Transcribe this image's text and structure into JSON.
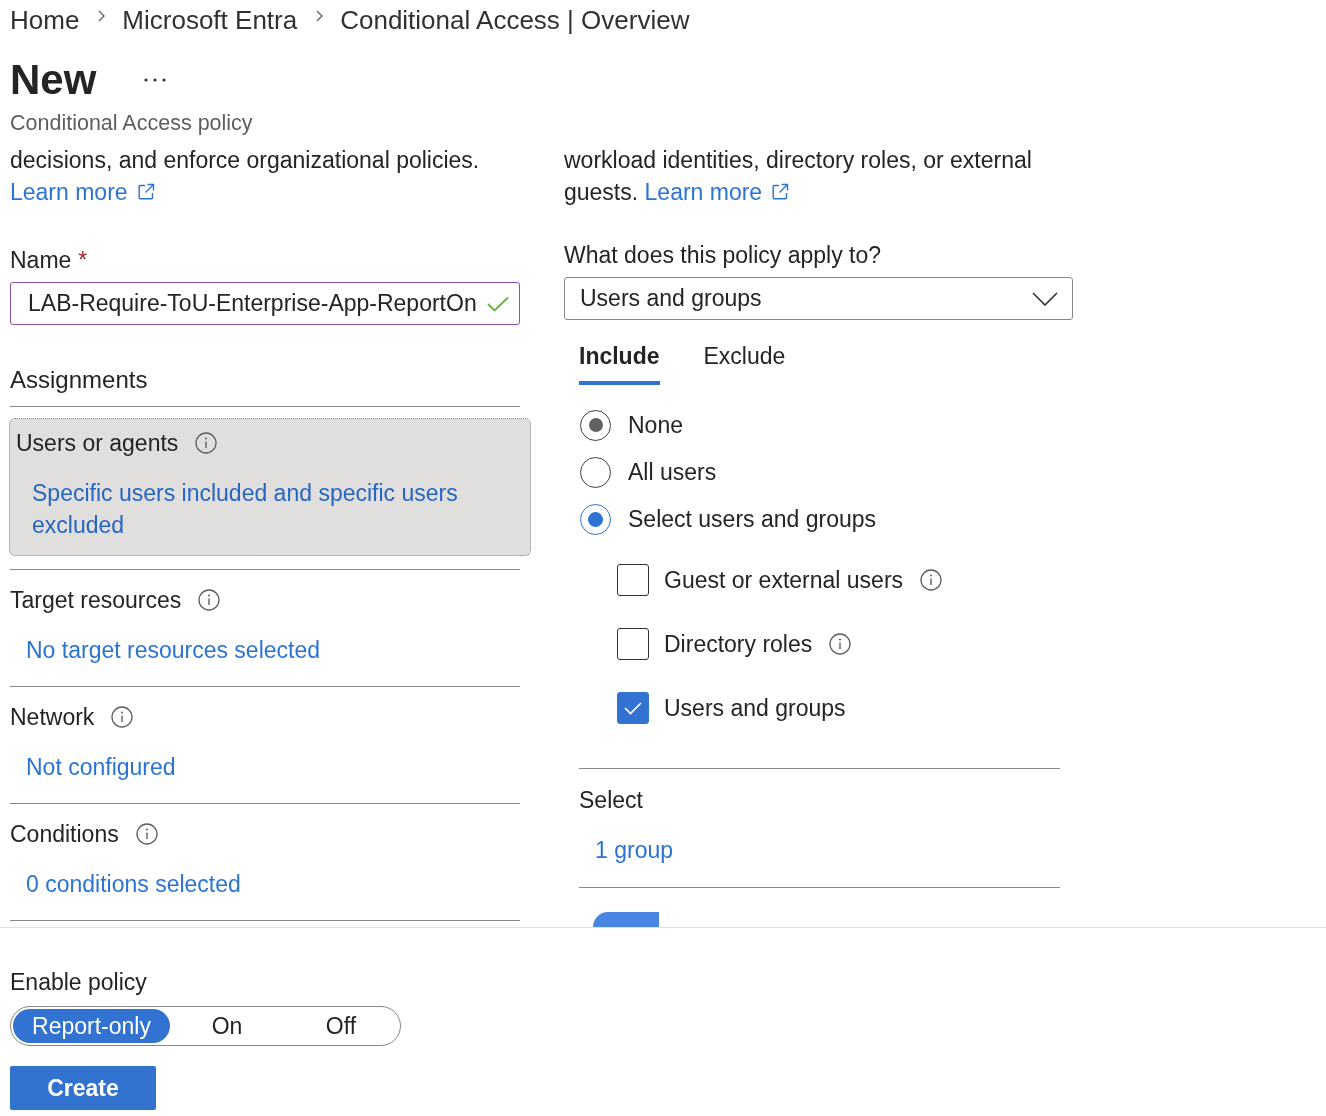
{
  "breadcrumb": [
    {
      "label": "Home"
    },
    {
      "label": "Microsoft Entra"
    },
    {
      "label": "Conditional Access | Overview"
    }
  ],
  "page": {
    "title": "New",
    "subtitle": "Conditional Access policy"
  },
  "left": {
    "intro": {
      "text": "decisions, and enforce organizational policies.",
      "link": "Learn more"
    },
    "name_field": {
      "label": "Name",
      "required_mark": "*",
      "value": "LAB-Require-ToU-Enterprise-App-ReportOn",
      "valid": true
    },
    "assignments": {
      "heading": "Assignments",
      "sections": [
        {
          "title": "Users or agents",
          "value": "Specific users included and specific users excluded",
          "selected": true
        },
        {
          "title": "Target resources",
          "value": "No target resources selected",
          "selected": false
        },
        {
          "title": "Network",
          "value": "Not configured",
          "selected": false
        },
        {
          "title": "Conditions",
          "value": "0 conditions selected",
          "selected": false
        }
      ]
    }
  },
  "right": {
    "intro": {
      "text": "workload identities, directory roles, or external guests.",
      "link": "Learn more"
    },
    "apply_to": {
      "label": "What does this policy apply to?",
      "value": "Users and groups"
    },
    "tabs": [
      {
        "label": "Include",
        "selected": true
      },
      {
        "label": "Exclude",
        "selected": false
      }
    ],
    "radios": [
      {
        "label": "None",
        "selected": false,
        "hovered": true
      },
      {
        "label": "All users",
        "selected": false,
        "hovered": false
      },
      {
        "label": "Select users and groups",
        "selected": true,
        "hovered": false
      }
    ],
    "checkboxes": [
      {
        "label": "Guest or external users",
        "checked": false,
        "info": true
      },
      {
        "label": "Directory roles",
        "checked": false,
        "info": true
      },
      {
        "label": "Users and groups",
        "checked": true,
        "info": false
      }
    ],
    "select": {
      "label": "Select",
      "value": "1 group"
    }
  },
  "enable_policy": {
    "label": "Enable policy",
    "options": [
      {
        "label": "Report-only",
        "selected": true
      },
      {
        "label": "On",
        "selected": false
      },
      {
        "label": "Off",
        "selected": false
      }
    ]
  },
  "create_button": {
    "label": "Create"
  }
}
